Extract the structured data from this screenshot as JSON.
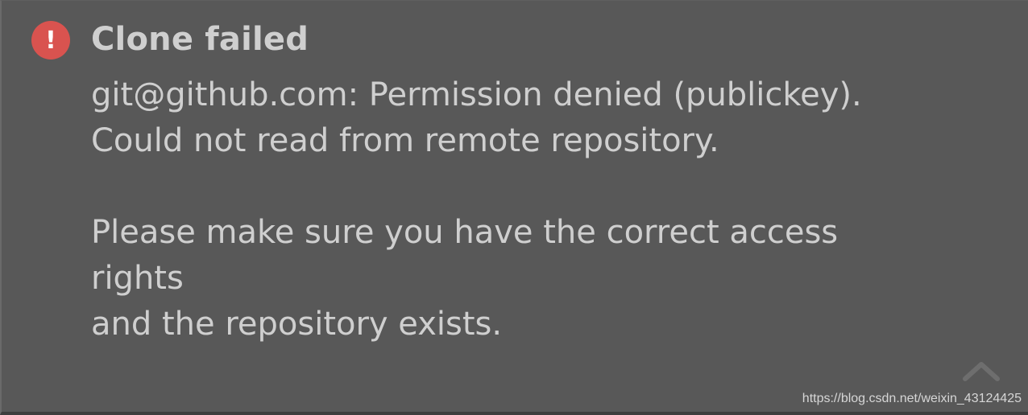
{
  "notification": {
    "icon": "error-icon",
    "icon_glyph": "!",
    "icon_color": "#d9534f",
    "title": "Clone failed",
    "lines": [
      "git@github.com: Permission denied (publickey).",
      "Could not read from remote repository.",
      "",
      "Please make sure you have the correct access",
      "rights",
      "and the repository exists."
    ],
    "collapse_icon": "chevron-up-icon"
  },
  "watermark": "https://blog.csdn.net/weixin_43124425",
  "colors": {
    "background": "#585858",
    "text": "#cfcfcf",
    "error": "#d9534f"
  }
}
